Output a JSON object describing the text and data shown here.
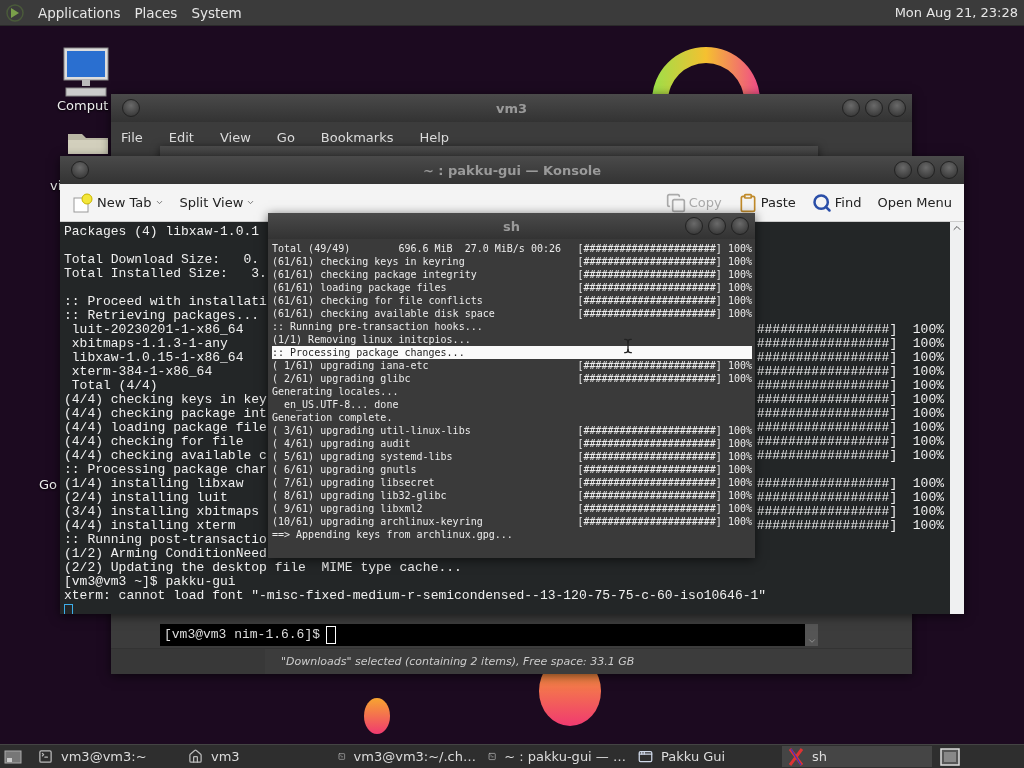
{
  "top_panel": {
    "menus": [
      "Applications",
      "Places",
      "System"
    ],
    "clock": "Mon Aug 21, 23:28"
  },
  "desktop_icons": [
    {
      "label": "Comput",
      "kind": "computer"
    },
    {
      "label": "vi",
      "kind": "folder"
    },
    {
      "label": "Go",
      "kind": "hidden"
    }
  ],
  "file_manager": {
    "title": "vm3",
    "menu": [
      "File",
      "Edit",
      "View",
      "Go",
      "Bookmarks",
      "Help"
    ],
    "terminal_prompt": "[vm3@vm3 nim-1.6.6]$",
    "status": "\"Downloads\" selected (containing 2 items), Free space: 33.1 GB"
  },
  "konsole": {
    "title": "~ : pakku-gui — Konsole",
    "toolbar": [
      {
        "label": "New Tab",
        "kind": "new-tab",
        "disabled": false,
        "dropdown": true
      },
      {
        "label": "Split View",
        "kind": "none",
        "disabled": false,
        "dropdown": true
      },
      {
        "label": "Copy",
        "kind": "copy",
        "disabled": true,
        "dropdown": false
      },
      {
        "label": "Paste",
        "kind": "paste",
        "disabled": false,
        "dropdown": false
      },
      {
        "label": "Find",
        "kind": "find",
        "disabled": false,
        "dropdown": false
      },
      {
        "label": "Open Menu",
        "kind": "none",
        "disabled": false,
        "dropdown": false
      }
    ],
    "blocks": [
      {
        "lines": [
          {
            "text": "Packages (4) libxaw-1.0.1"
          }
        ]
      },
      {
        "lines": [
          {
            "text": "Total Download Size:   0."
          },
          {
            "text": "Total Installed Size:   3."
          }
        ]
      },
      {
        "lines": [
          {
            "text": ":: Proceed with installati"
          },
          {
            "text": ":: Retrieving packages..."
          },
          {
            "text": " luit-20230201-1-x86_64",
            "right": "#################]  100%"
          },
          {
            "text": " xbitmaps-1.1.3-1-any",
            "right": "#################]  100%"
          },
          {
            "text": " libxaw-1.0.15-1-x86_64",
            "right": "#################]  100%"
          },
          {
            "text": " xterm-384-1-x86_64",
            "right": "#################]  100%"
          },
          {
            "text": " Total (4/4)",
            "right": "#################]  100%"
          },
          {
            "text": "(4/4) checking keys in key",
            "right": "#################]  100%"
          },
          {
            "text": "(4/4) checking package int",
            "right": "#################]  100%"
          },
          {
            "text": "(4/4) loading package file",
            "right": "#################]  100%"
          },
          {
            "text": "(4/4) checking for file",
            "right": "#################]  100%"
          },
          {
            "text": "(4/4) checking available c",
            "right": "#################]  100%"
          },
          {
            "text": ":: Processing package char"
          },
          {
            "text": "(1/4) installing libxaw",
            "right": "#################]  100%"
          },
          {
            "text": "(2/4) installing luit",
            "right": "#################]  100%"
          },
          {
            "text": "(3/4) installing xbitmaps",
            "right": "#################]  100%"
          },
          {
            "text": "(4/4) installing xterm",
            "right": "#################]  100%"
          },
          {
            "text": ":: Running post-transactio"
          },
          {
            "text": "(1/2) Arming ConditionNeed"
          },
          {
            "text": "(2/2) Updating the desktop file  MIME type cache..."
          },
          {
            "text": "[vm3@vm3 ~]$ pakku-gui"
          },
          {
            "text": "xterm: cannot load font \"-misc-fixed-medium-r-semicondensed--13-120-75-75-c-60-iso10646-1\""
          }
        ]
      }
    ]
  },
  "sh_window": {
    "title": "sh",
    "lines": [
      {
        "text": "Total (49/49)        696.6 MiB  27.0 MiB/s 00:26",
        "right": "[######################] 100%",
        "highlighted": false
      },
      {
        "text": "(61/61) checking keys in keyring",
        "right": "[######################] 100%",
        "highlighted": false
      },
      {
        "text": "(61/61) checking package integrity",
        "right": "[######################] 100%",
        "highlighted": false
      },
      {
        "text": "(61/61) loading package files",
        "right": "[######################] 100%",
        "highlighted": false
      },
      {
        "text": "(61/61) checking for file conflicts",
        "right": "[######################] 100%",
        "highlighted": false
      },
      {
        "text": "(61/61) checking available disk space",
        "right": "[######################] 100%",
        "highlighted": false
      },
      {
        "text": ":: Running pre-transaction hooks...",
        "highlighted": false
      },
      {
        "text": "(1/1) Removing linux initcpios...",
        "highlighted": false
      },
      {
        "text": ":: Processing package changes...",
        "highlighted": true
      },
      {
        "text": "( 1/61) upgrading iana-etc",
        "right": "[######################] 100%",
        "highlighted": false
      },
      {
        "text": "( 2/61) upgrading glibc",
        "right": "[######################] 100%",
        "highlighted": false
      },
      {
        "text": "Generating locales...",
        "highlighted": false
      },
      {
        "text": "  en_US.UTF-8... done",
        "highlighted": false
      },
      {
        "text": "Generation complete.",
        "highlighted": false
      },
      {
        "text": "( 3/61) upgrading util-linux-libs",
        "right": "[######################] 100%",
        "highlighted": false
      },
      {
        "text": "( 4/61) upgrading audit",
        "right": "[######################] 100%",
        "highlighted": false
      },
      {
        "text": "( 5/61) upgrading systemd-libs",
        "right": "[######################] 100%",
        "highlighted": false
      },
      {
        "text": "( 6/61) upgrading gnutls",
        "right": "[######################] 100%",
        "highlighted": false
      },
      {
        "text": "( 7/61) upgrading libsecret",
        "right": "[######################] 100%",
        "highlighted": false
      },
      {
        "text": "( 8/61) upgrading lib32-glibc",
        "right": "[######################] 100%",
        "highlighted": false
      },
      {
        "text": "( 9/61) upgrading libxml2",
        "right": "[######################] 100%",
        "highlighted": false
      },
      {
        "text": "(10/61) upgrading archlinux-keyring",
        "right": "[######################] 100%",
        "highlighted": false
      },
      {
        "text": "==> Appending keys from archlinux.gpg...",
        "highlighted": false
      }
    ]
  },
  "taskbar": {
    "items": [
      {
        "label": "vm3@vm3:~",
        "kind": "terminal",
        "selected": false
      },
      {
        "label": "vm3",
        "kind": "home",
        "selected": false
      },
      {
        "label": "vm3@vm3:~/.ch…",
        "kind": "terminal",
        "selected": false
      },
      {
        "label": "~ : pakku-gui — …",
        "kind": "terminal",
        "selected": false
      },
      {
        "label": "Pakku Gui",
        "kind": "window",
        "selected": false
      },
      {
        "label": "sh",
        "kind": "x",
        "selected": true
      }
    ]
  }
}
